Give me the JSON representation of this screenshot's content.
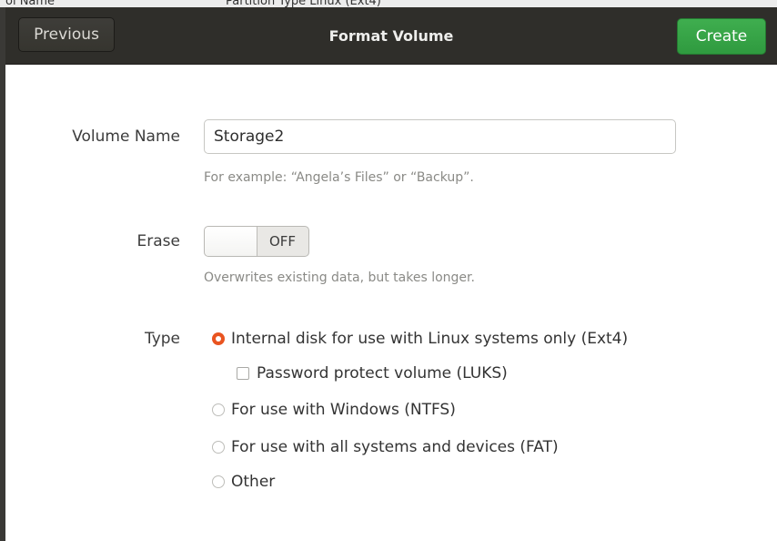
{
  "behind_window": {
    "fragment_left": "ol Name",
    "fragment_mid": "Partition Type Linux (Ext4)"
  },
  "header": {
    "previous_label": "Previous",
    "title": "Format Volume",
    "create_label": "Create"
  },
  "form": {
    "volume_name_label": "Volume Name",
    "volume_name_value": "Storage2",
    "volume_name_hint": "For example: “Angela’s Files” or “Backup”.",
    "erase_label": "Erase",
    "erase_state": "OFF",
    "erase_hint": "Overwrites existing data, but takes longer.",
    "type_label": "Type",
    "type_options": [
      {
        "label": "Internal disk for use with Linux systems only (Ext4)",
        "selected": true
      },
      {
        "label": "For use with Windows (NTFS)",
        "selected": false
      },
      {
        "label": "For use with all systems and devices (FAT)",
        "selected": false
      },
      {
        "label": "Other",
        "selected": false
      }
    ],
    "password_protect_label": "Password protect volume (LUKS)",
    "password_protect_checked": false
  },
  "colors": {
    "accent": "#e95420",
    "create_button": "#38a548",
    "header_bg": "#2f2e2a"
  }
}
